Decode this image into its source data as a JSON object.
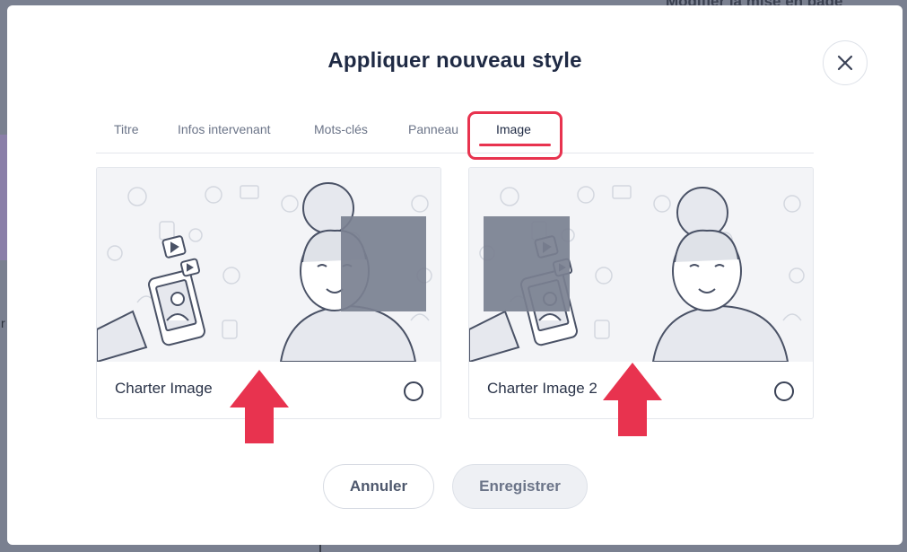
{
  "background": {
    "top_text": "Modifier la mise en page"
  },
  "modal": {
    "title": "Appliquer nouveau style",
    "close_icon": "close-icon"
  },
  "tabs": [
    {
      "label": "Titre"
    },
    {
      "label": "Infos intervenant"
    },
    {
      "label": "Mots-clés"
    },
    {
      "label": "Panneau"
    },
    {
      "label": "Image",
      "active": true
    }
  ],
  "cards": [
    {
      "label": "Charter Image",
      "selected": false
    },
    {
      "label": "Charter Image 2",
      "selected": false
    }
  ],
  "buttons": {
    "cancel": "Annuler",
    "save": "Enregistrer"
  },
  "colors": {
    "accent": "#e8334f",
    "overlay_square": "#7a8090",
    "title": "#1f2a44"
  }
}
